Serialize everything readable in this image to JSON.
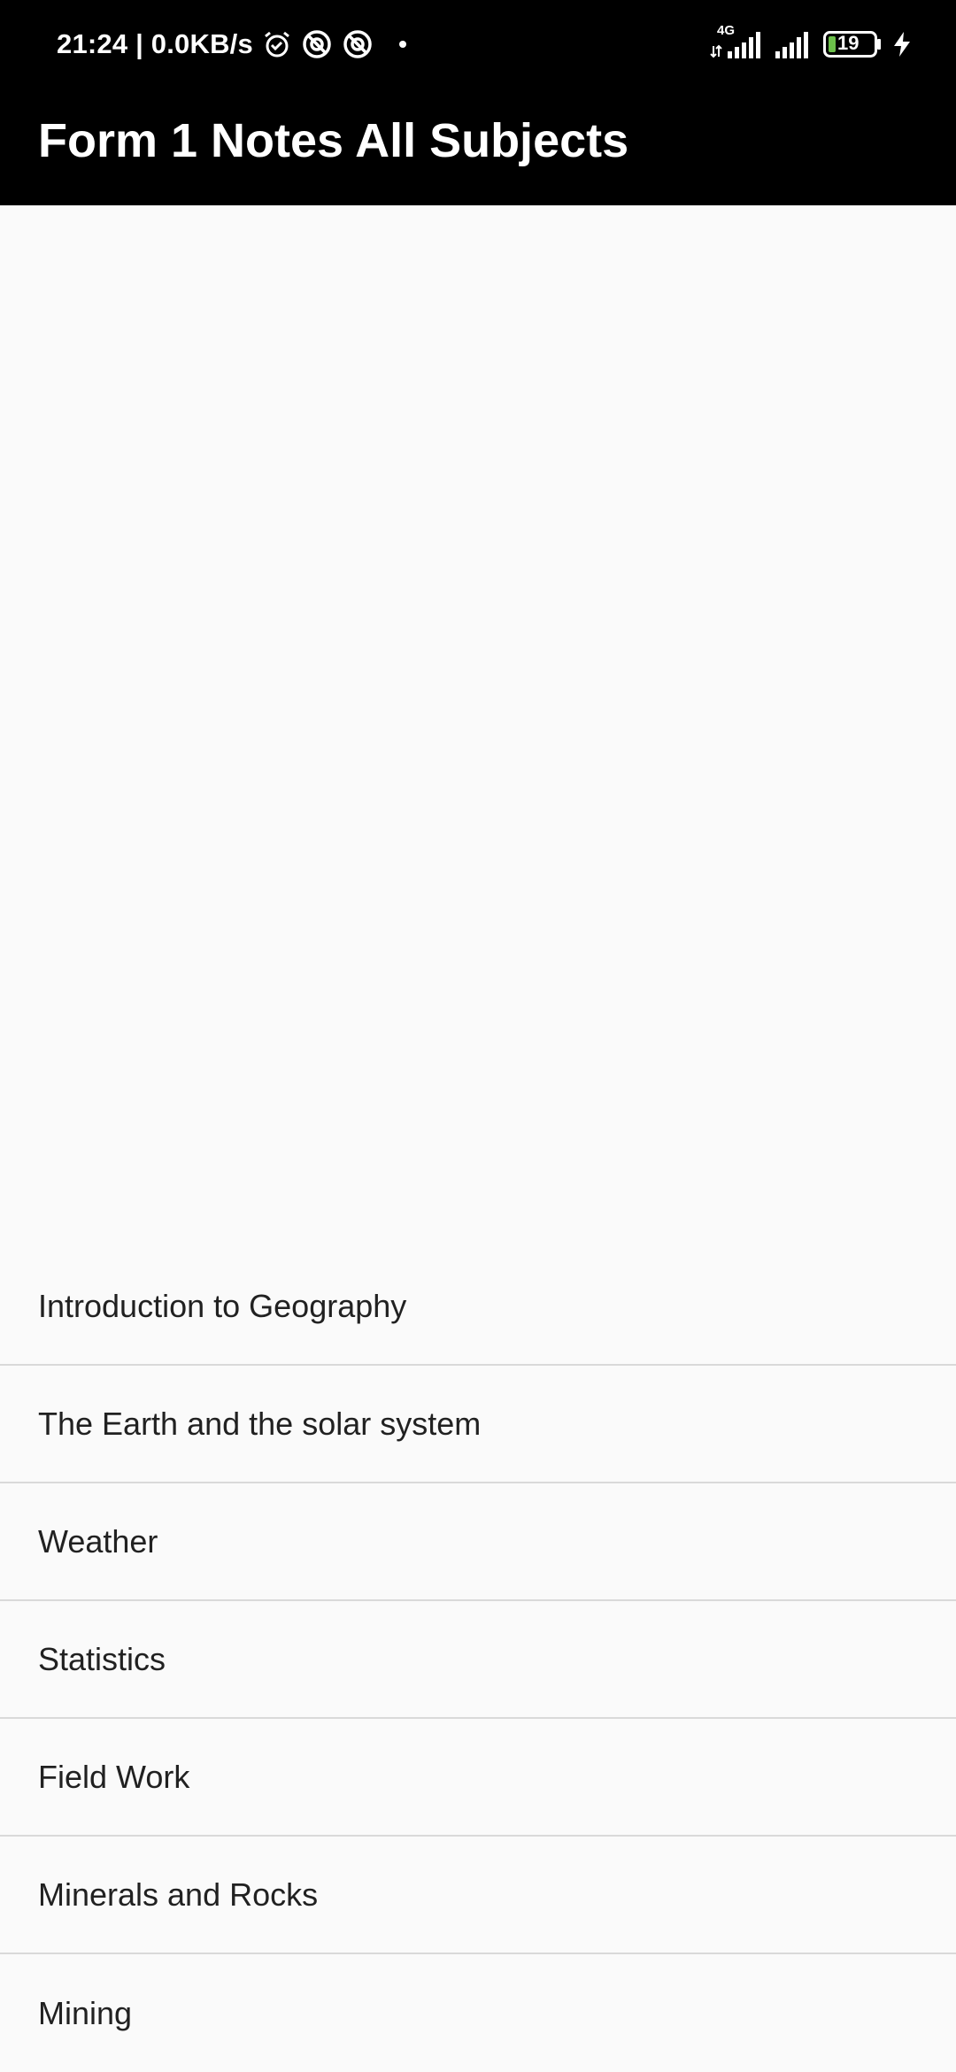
{
  "status_bar": {
    "time_speed": "21:24 | 0.0KB/s",
    "network_label": "4G",
    "battery_level": "19",
    "icons": [
      "alarm-icon",
      "data-saver-icon",
      "data-saver-icon",
      "notification-dot-icon",
      "signal-4g-icon",
      "signal-icon",
      "battery-icon",
      "charging-icon"
    ]
  },
  "app_bar": {
    "title": "Form 1 Notes All Subjects"
  },
  "topics": [
    {
      "label": "Introduction to Geography"
    },
    {
      "label": "The Earth and the solar system"
    },
    {
      "label": "Weather"
    },
    {
      "label": "Statistics"
    },
    {
      "label": "Field Work"
    },
    {
      "label": "Minerals and Rocks"
    },
    {
      "label": "Mining"
    }
  ],
  "colors": {
    "bar_background": "#000000",
    "content_background": "#fafafa",
    "text_primary": "#212121",
    "divider": "#d9d9d9",
    "battery_fill": "#6cc04a"
  }
}
